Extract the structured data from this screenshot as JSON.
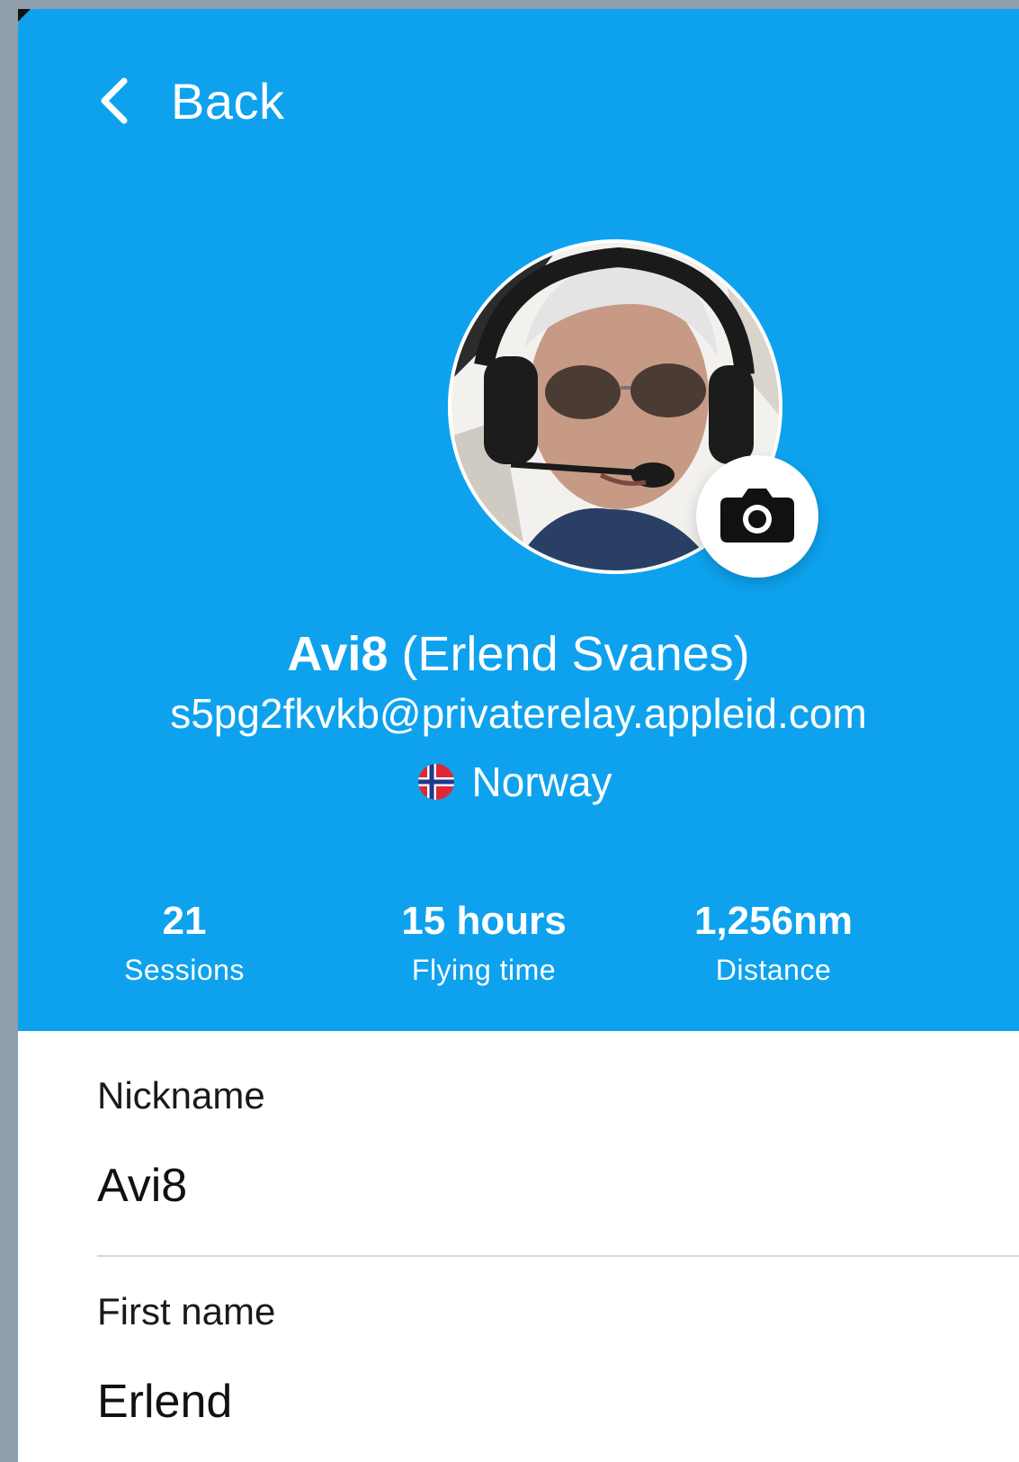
{
  "header": {
    "back_label": "Back",
    "background_color": "#0ea2ee"
  },
  "profile": {
    "nickname": "Avi8",
    "full_name": "(Erlend Svanes)",
    "email": "s5pg2fkvkb@privaterelay.appleid.com",
    "country": "Norway",
    "country_flag": "norway-flag-icon",
    "avatar_icon": "camera-icon"
  },
  "stats": [
    {
      "value": "21",
      "label": "Sessions"
    },
    {
      "value": "15 hours",
      "label": "Flying time"
    },
    {
      "value": "1,256nm",
      "label": "Distance"
    }
  ],
  "form": {
    "nickname_label": "Nickname",
    "nickname_value": "Avi8",
    "first_name_label": "First name",
    "first_name_value": "Erlend"
  }
}
